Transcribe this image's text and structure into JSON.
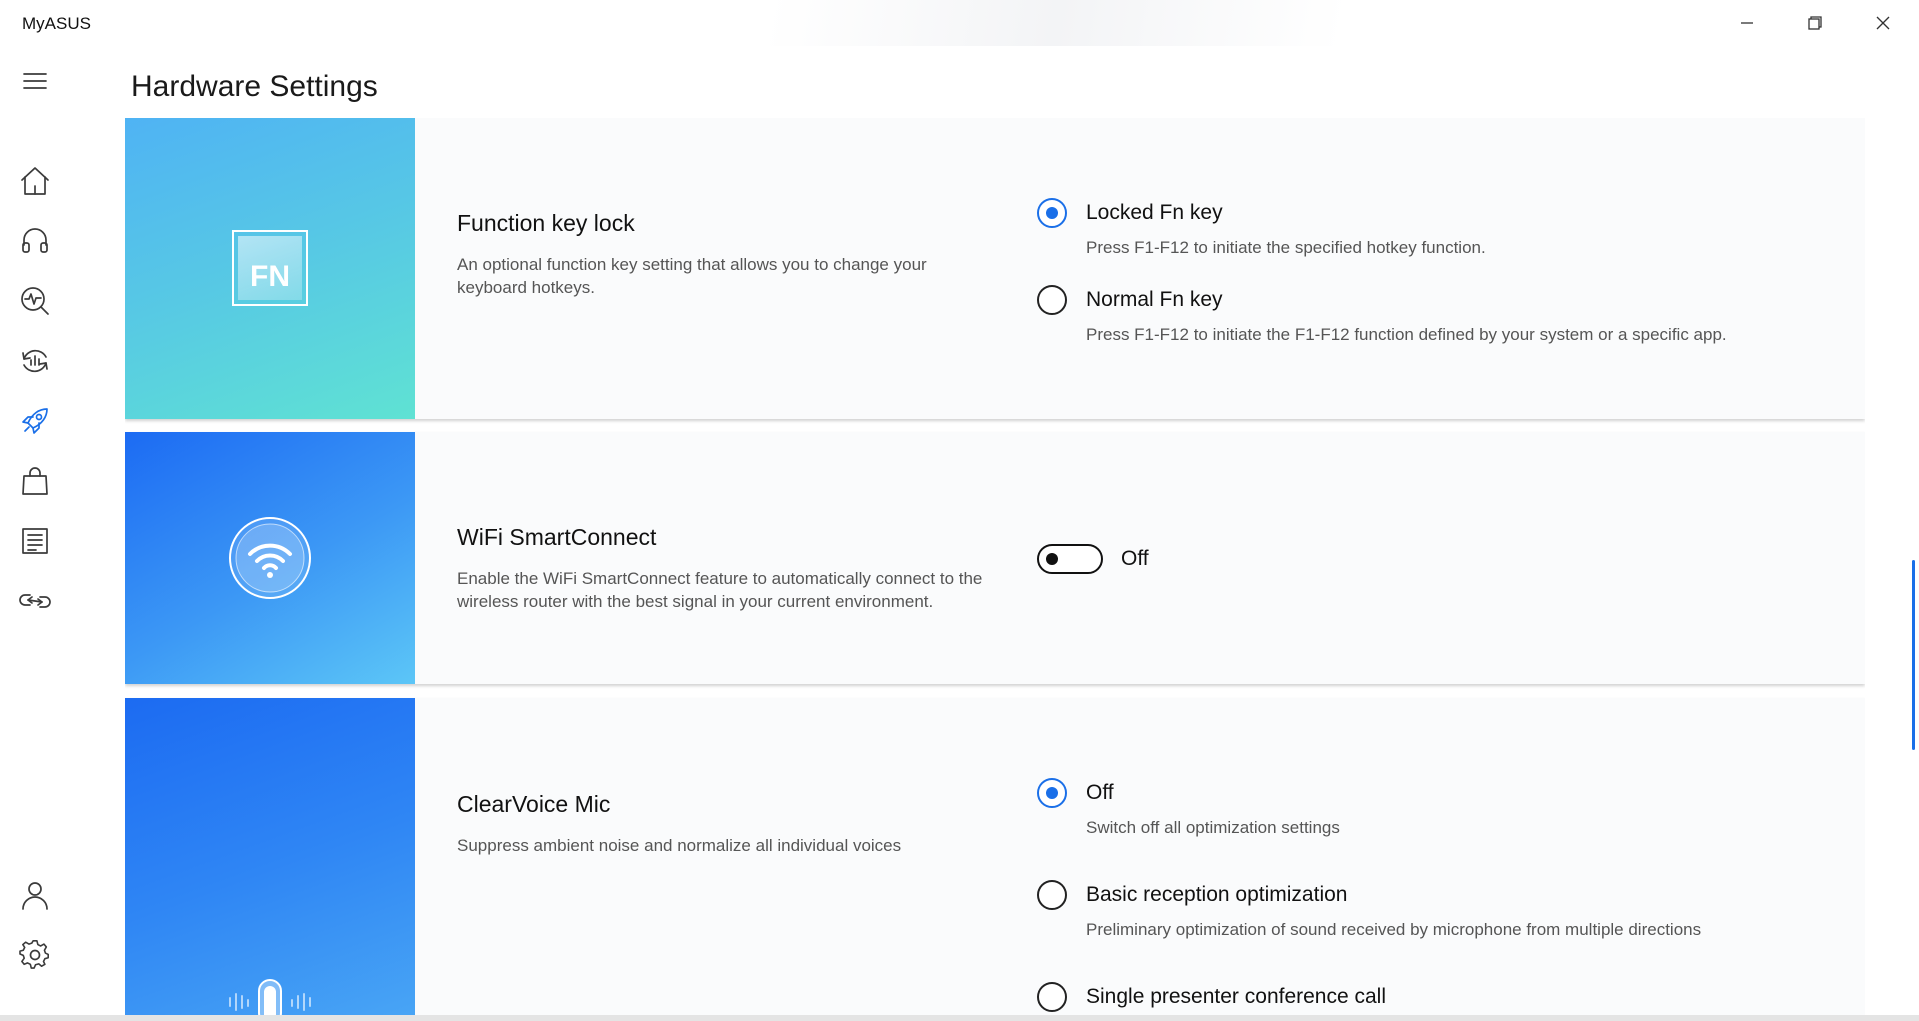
{
  "app": {
    "title": "MyASUS"
  },
  "window_controls": {
    "minimize": "minimize-icon",
    "maximize": "restore-icon",
    "close": "close-icon"
  },
  "page": {
    "title": "Hardware Settings"
  },
  "sidebar": {
    "items": [
      {
        "name": "home",
        "icon": "home-icon"
      },
      {
        "name": "support",
        "icon": "headset-icon"
      },
      {
        "name": "diagnostics",
        "icon": "diagnostics-icon"
      },
      {
        "name": "updates",
        "icon": "update-icon"
      },
      {
        "name": "customization",
        "icon": "rocket-icon",
        "active": true
      },
      {
        "name": "store",
        "icon": "shopping-bag-icon"
      },
      {
        "name": "news",
        "icon": "article-icon"
      },
      {
        "name": "link",
        "icon": "link-icon"
      },
      {
        "name": "account",
        "icon": "user-icon"
      },
      {
        "name": "settings",
        "icon": "gear-icon"
      }
    ]
  },
  "cards": {
    "fn_lock": {
      "badge": "FN",
      "title": "Function key lock",
      "description": "An optional function key setting that allows you to change your keyboard hotkeys.",
      "options": [
        {
          "label": "Locked Fn key",
          "sub": "Press F1-F12 to initiate the specified hotkey function.",
          "checked": true
        },
        {
          "label": "Normal Fn key",
          "sub": "Press F1-F12 to initiate the F1-F12 function defined by your system or a specific app.",
          "checked": false
        }
      ]
    },
    "wifi": {
      "title": "WiFi SmartConnect",
      "description": "Enable the WiFi SmartConnect feature to automatically connect to the wireless router with the best signal in your current environment.",
      "toggle_state": "Off"
    },
    "clearvoice": {
      "title": "ClearVoice Mic",
      "description": "Suppress ambient noise and normalize all individual voices",
      "options": [
        {
          "label": "Off",
          "sub": "Switch off all optimization settings",
          "checked": true
        },
        {
          "label": "Basic reception optimization",
          "sub": "Preliminary optimization of sound received by microphone from multiple directions",
          "checked": false
        },
        {
          "label": "Single presenter conference call",
          "sub": "",
          "checked": false
        }
      ]
    }
  },
  "colors": {
    "accent": "#1a6fe8",
    "fn_gradient": [
      "#4fb7f2",
      "#5de0d4"
    ],
    "wifi_gradient": [
      "#1e6ff3",
      "#5cc4f6"
    ],
    "mic_gradient": [
      "#1c6cf2",
      "#52b2f6"
    ]
  }
}
